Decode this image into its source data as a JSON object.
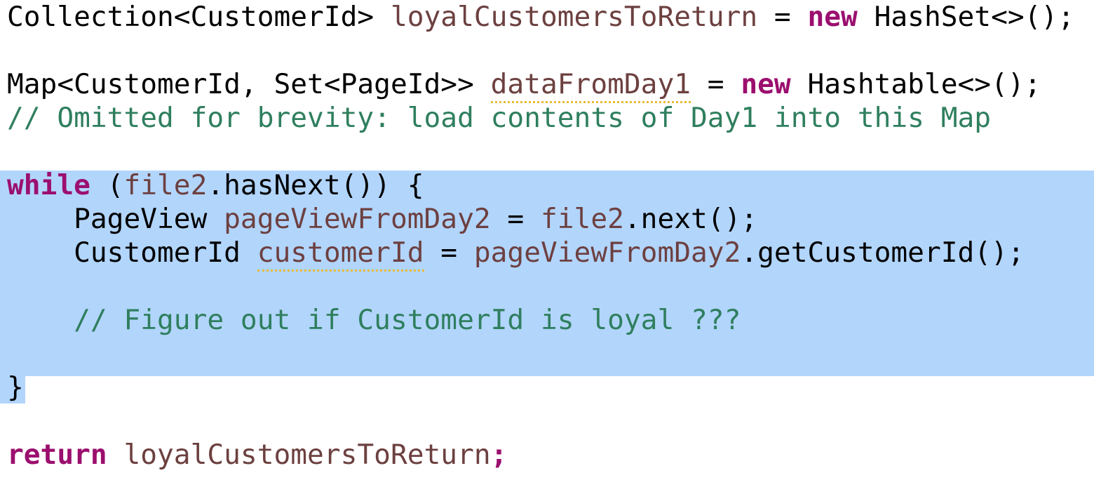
{
  "editor": {
    "language": "java",
    "background_color": "#ffffff",
    "selection_color": "#b2d5fc",
    "colors": {
      "plain": "#000000",
      "identifier": "#6d4040",
      "keyword": "#9b0f6e",
      "comment": "#2f7f5e",
      "spellcheck_underline": "#e8bb33"
    }
  },
  "lines": [
    {
      "index": 1,
      "selected": false,
      "text": "Collection<CustomerId> loyalCustomersToReturn = new HashSet<>();",
      "tokens": [
        {
          "t": "Collection<CustomerId> ",
          "k": "plain"
        },
        {
          "t": "loyalCustomersToReturn",
          "k": "ident"
        },
        {
          "t": " = ",
          "k": "plain"
        },
        {
          "t": "new",
          "k": "keyword"
        },
        {
          "t": " HashSet<>();",
          "k": "plain"
        }
      ]
    },
    {
      "index": 2,
      "selected": false,
      "text": "",
      "tokens": []
    },
    {
      "index": 3,
      "selected": false,
      "text": "Map<CustomerId, Set<PageId>> dataFromDay1 = new Hashtable<>();",
      "tokens": [
        {
          "t": "Map<CustomerId, Set<PageId>> ",
          "k": "plain"
        },
        {
          "t": "dataFromDay1",
          "k": "underline"
        },
        {
          "t": " = ",
          "k": "plain"
        },
        {
          "t": "new",
          "k": "keyword"
        },
        {
          "t": " Hashtable<>();",
          "k": "plain"
        }
      ]
    },
    {
      "index": 4,
      "selected": false,
      "text": "// Omitted for brevity: load contents of Day1 into this Map",
      "tokens": [
        {
          "t": "// Omitted for brevity: load contents of Day1 into this Map",
          "k": "comment"
        }
      ]
    },
    {
      "index": 5,
      "selected": false,
      "text": "",
      "tokens": []
    },
    {
      "index": 6,
      "selected": true,
      "text": "while (file2.hasNext()) {",
      "tokens": [
        {
          "t": "while",
          "k": "keyword"
        },
        {
          "t": " (",
          "k": "plain"
        },
        {
          "t": "file2",
          "k": "ident"
        },
        {
          "t": ".hasNext()) {",
          "k": "plain"
        }
      ]
    },
    {
      "index": 7,
      "selected": true,
      "text": "    PageView pageViewFromDay2 = file2.next();",
      "tokens": [
        {
          "t": "    PageView ",
          "k": "plain"
        },
        {
          "t": "pageViewFromDay2",
          "k": "ident"
        },
        {
          "t": " = ",
          "k": "plain"
        },
        {
          "t": "file2",
          "k": "ident"
        },
        {
          "t": ".next();",
          "k": "plain"
        }
      ]
    },
    {
      "index": 8,
      "selected": true,
      "text": "    CustomerId customerId = pageViewFromDay2.getCustomerId();",
      "tokens": [
        {
          "t": "    CustomerId ",
          "k": "plain"
        },
        {
          "t": "customerId",
          "k": "underline"
        },
        {
          "t": " = ",
          "k": "plain"
        },
        {
          "t": "pageViewFromDay2",
          "k": "ident"
        },
        {
          "t": ".getCustomerId();",
          "k": "plain"
        }
      ]
    },
    {
      "index": 9,
      "selected": true,
      "text": "",
      "tokens": []
    },
    {
      "index": 10,
      "selected": true,
      "text": "    // Figure out if CustomerId is loyal ???",
      "tokens": [
        {
          "t": "    ",
          "k": "plain"
        },
        {
          "t": "// Figure out if CustomerId is loyal ???",
          "k": "comment"
        }
      ]
    },
    {
      "index": 11,
      "selected": true,
      "text": "",
      "tokens": []
    },
    {
      "index": 12,
      "selected": true,
      "text": "}",
      "tokens": [
        {
          "t": "}",
          "k": "plain"
        }
      ]
    },
    {
      "index": 13,
      "selected": false,
      "text": "",
      "tokens": []
    },
    {
      "index": 14,
      "selected": false,
      "text": "return loyalCustomersToReturn;",
      "tokens": [
        {
          "t": "return",
          "k": "keyword"
        },
        {
          "t": " ",
          "k": "plain"
        },
        {
          "t": "loyalCustomersToReturn",
          "k": "ident"
        },
        {
          "t": ";",
          "k": "semi-kw"
        }
      ]
    }
  ]
}
